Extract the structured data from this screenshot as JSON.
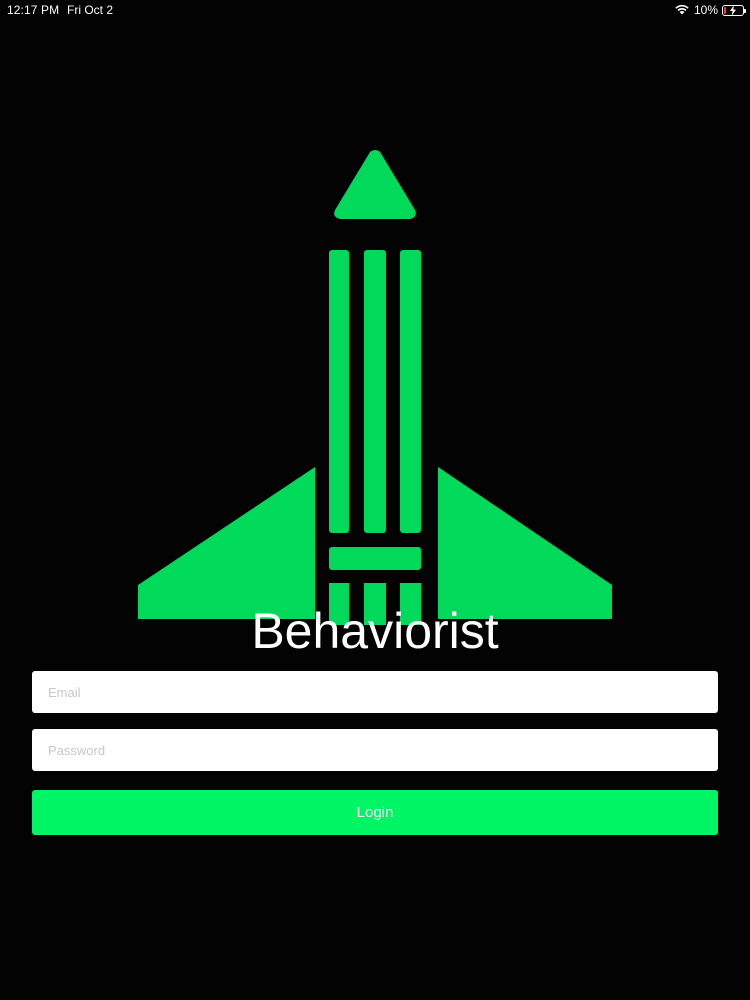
{
  "status_bar": {
    "time": "12:17 PM",
    "date": "Fri Oct 2",
    "battery_percent": "10%",
    "battery_level": 0.1,
    "icons": [
      "wifi-icon",
      "battery-icon",
      "charging-bolt-icon"
    ]
  },
  "logo": {
    "icon": "pencil-rocket-logo",
    "color": "#00d95a"
  },
  "app": {
    "title": "Behaviorist"
  },
  "login_form": {
    "email_placeholder": "Email",
    "email_value": "",
    "password_placeholder": "Password",
    "password_value": "",
    "login_label": "Login",
    "button_color": "#00f564"
  },
  "colors": {
    "background": "#030303",
    "accent": "#00d95a",
    "text": "#ffffff"
  }
}
